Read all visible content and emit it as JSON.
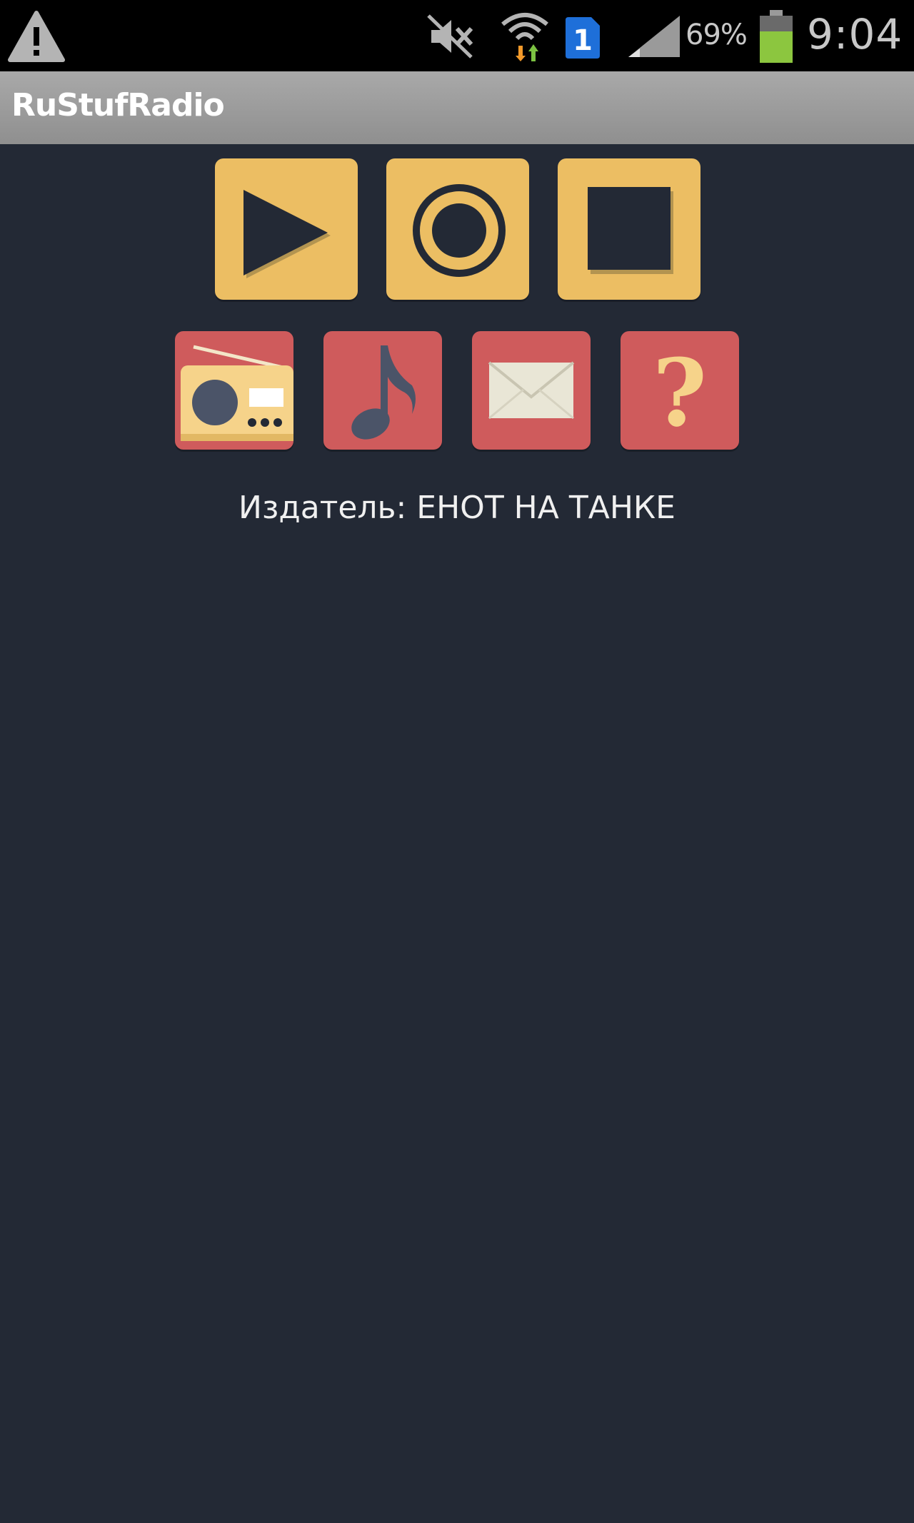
{
  "status_bar": {
    "battery_percent": "69%",
    "clock": "9:04",
    "sim_slot": "1",
    "icons": [
      "warning-icon",
      "mute-icon",
      "wifi-icon",
      "sim-icon",
      "signal-icon",
      "battery-icon"
    ]
  },
  "app": {
    "title": "RuStufRadio"
  },
  "controls": {
    "play_icon": "play-icon",
    "record_icon": "record-icon",
    "stop_icon": "stop-icon"
  },
  "menu": {
    "radio_icon": "radio-icon",
    "music_icon": "music-note-icon",
    "mail_icon": "envelope-icon",
    "help_icon": "question-mark-icon",
    "help_glyph": "?"
  },
  "footer": {
    "publisher": "Издатель: ЕНОТ НА ТАНКЕ"
  },
  "colors": {
    "background": "#232935",
    "gold_tile": "#ecbe63",
    "red_tile": "#cf5b5c",
    "action_bar": "#9c9c9c",
    "status_bar": "#000000"
  }
}
